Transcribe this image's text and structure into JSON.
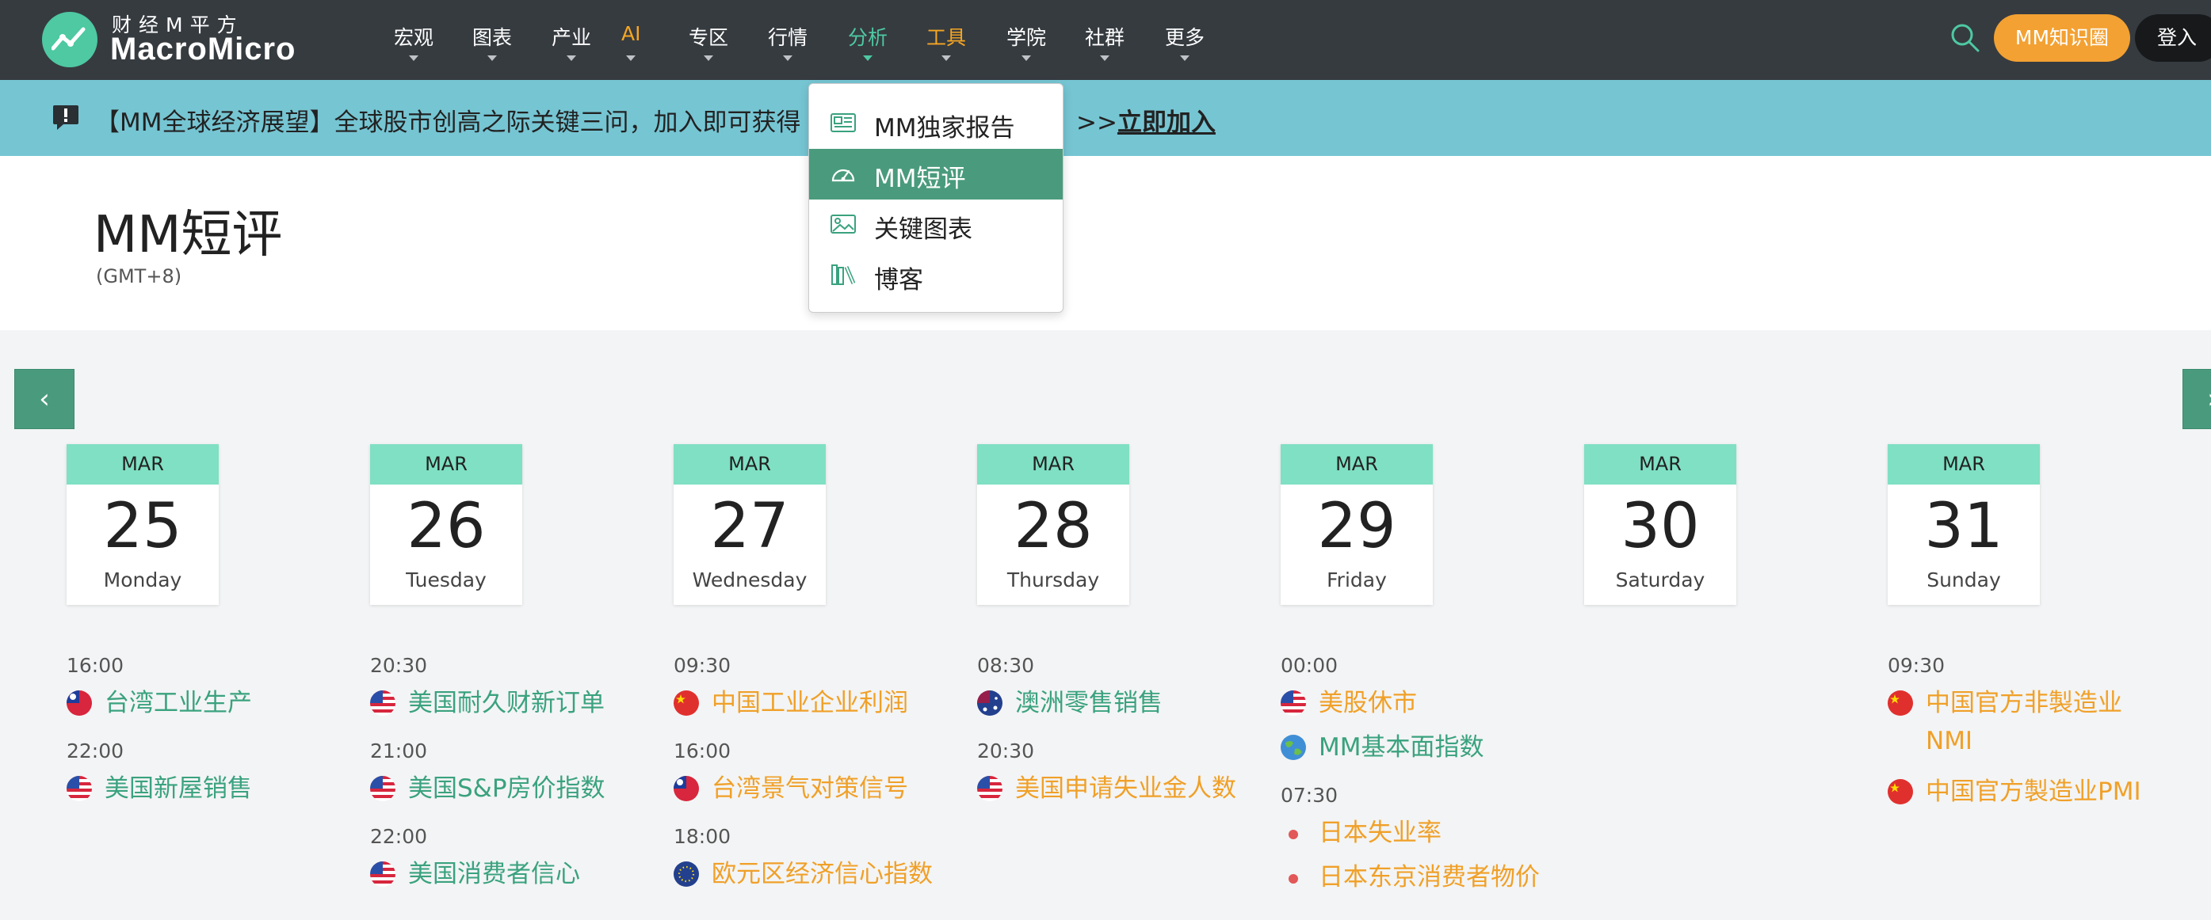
{
  "brand": {
    "cn": "财经M平方",
    "en": "MacroMicro"
  },
  "nav": [
    {
      "label": "宏观",
      "style": "normal"
    },
    {
      "label": "图表",
      "style": "normal"
    },
    {
      "label": "产业",
      "style": "normal"
    },
    {
      "label": "AI",
      "style": "orange"
    },
    {
      "label": "专区",
      "style": "normal"
    },
    {
      "label": "行情",
      "style": "normal"
    },
    {
      "label": "分析",
      "style": "green"
    },
    {
      "label": "工具",
      "style": "orange"
    },
    {
      "label": "学院",
      "style": "normal"
    },
    {
      "label": "社群",
      "style": "normal"
    },
    {
      "label": "更多",
      "style": "normal"
    }
  ],
  "actions": {
    "knowledge": "MM知识圈",
    "login": "登入"
  },
  "banner": {
    "text": "【MM全球经济展望】全球股市创高之际关键三问，加入即可获得",
    "link_prefix": ">>",
    "link": "立即加入"
  },
  "page": {
    "title": "MM短评",
    "timezone": "(GMT+8)"
  },
  "dropdown": [
    {
      "label": "MM独家报告",
      "icon": "newspaper-icon",
      "active": false
    },
    {
      "label": "MM短评",
      "icon": "gauge-icon",
      "active": true
    },
    {
      "label": "关键图表",
      "icon": "image-icon",
      "active": false
    },
    {
      "label": "博客",
      "icon": "books-icon",
      "active": false
    }
  ],
  "days": [
    {
      "month": "MAR",
      "day": "25",
      "weekday": "Monday"
    },
    {
      "month": "MAR",
      "day": "26",
      "weekday": "Tuesday"
    },
    {
      "month": "MAR",
      "day": "27",
      "weekday": "Wednesday"
    },
    {
      "month": "MAR",
      "day": "28",
      "weekday": "Thursday"
    },
    {
      "month": "MAR",
      "day": "29",
      "weekday": "Friday"
    },
    {
      "month": "MAR",
      "day": "30",
      "weekday": "Saturday"
    },
    {
      "month": "MAR",
      "day": "31",
      "weekday": "Sunday"
    }
  ],
  "events": [
    [
      {
        "time": "16:00",
        "items": [
          {
            "name": "台湾工业生产",
            "flag": "tw",
            "color": "green"
          }
        ]
      },
      {
        "time": "22:00",
        "items": [
          {
            "name": "美国新屋销售",
            "flag": "us",
            "color": "green"
          }
        ]
      }
    ],
    [
      {
        "time": "20:30",
        "items": [
          {
            "name": "美国耐久财新订单",
            "flag": "us",
            "color": "green"
          }
        ]
      },
      {
        "time": "21:00",
        "items": [
          {
            "name": "美国S&P房价指数",
            "flag": "us",
            "color": "green"
          }
        ]
      },
      {
        "time": "22:00",
        "items": [
          {
            "name": "美国消费者信心",
            "flag": "us",
            "color": "green"
          }
        ]
      }
    ],
    [
      {
        "time": "09:30",
        "items": [
          {
            "name": "中国工业企业利润",
            "flag": "cn",
            "color": "orange"
          }
        ]
      },
      {
        "time": "16:00",
        "items": [
          {
            "name": "台湾景气对策信号",
            "flag": "tw",
            "color": "orange"
          }
        ]
      },
      {
        "time": "18:00",
        "items": [
          {
            "name": "欧元区经济信心指数",
            "flag": "eu",
            "color": "orange"
          }
        ]
      }
    ],
    [
      {
        "time": "08:30",
        "items": [
          {
            "name": "澳洲零售销售",
            "flag": "au",
            "color": "green"
          }
        ]
      },
      {
        "time": "20:30",
        "items": [
          {
            "name": "美国申请失业金人数",
            "flag": "us",
            "color": "orange"
          }
        ]
      }
    ],
    [
      {
        "time": "00:00",
        "items": [
          {
            "name": "美股休市",
            "flag": "us",
            "color": "orange"
          },
          {
            "name": "MM基本面指数",
            "flag": "globe",
            "color": "green"
          }
        ]
      },
      {
        "time": "07:30",
        "items": [
          {
            "name": "日本失业率",
            "flag": "jp",
            "color": "orange"
          },
          {
            "name": "日本东京消费者物价",
            "flag": "jp",
            "color": "orange"
          }
        ]
      }
    ],
    [],
    [
      {
        "time": "09:30",
        "items": [
          {
            "name": "中国官方非製造业\nNMI",
            "flag": "cn",
            "color": "orange"
          },
          {
            "name": "中国官方製造业PMI",
            "flag": "cn",
            "color": "orange"
          }
        ]
      }
    ]
  ],
  "colors": {
    "nav_bg": "#363b40",
    "banner_bg": "#76c5d3",
    "accent_green": "#4a9b7d",
    "card_mint": "#7fe0c3",
    "orange": "#f0a028",
    "green_text": "#3aa27e"
  }
}
